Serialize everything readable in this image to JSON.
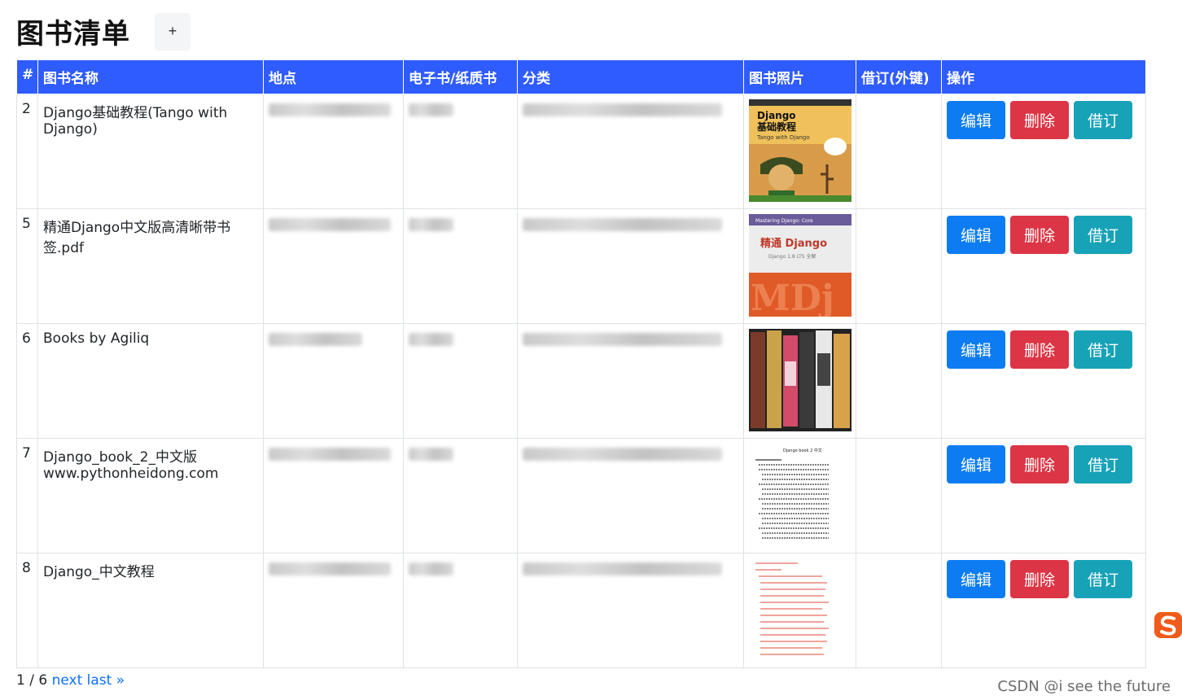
{
  "page": {
    "title": "图书清单",
    "add_label": "+"
  },
  "table": {
    "headers": [
      "#",
      "图书名称",
      "地点",
      "电子书/纸质书",
      "分类",
      "图书照片",
      "借订(外键)",
      "操作"
    ],
    "rows": [
      {
        "num": "2",
        "name": "Django基础教程(Tango with Django)",
        "cover": "cover-django-basics"
      },
      {
        "num": "5",
        "name": "精通Django中文版高清晰带书签.pdf",
        "cover": "cover-mastering-django"
      },
      {
        "num": "6",
        "name": "Books by Agiliq",
        "cover": "cover-agiliq-books"
      },
      {
        "num": "7",
        "name": "Django_book_2_中文版 www.pythonheidong.com",
        "cover": "cover-django-book-2"
      },
      {
        "num": "8",
        "name": "Django_中文教程",
        "cover": "cover-django-tutorial"
      }
    ]
  },
  "actions": {
    "edit_label": "编辑",
    "delete_label": "删除",
    "borrow_label": "借订"
  },
  "cover_texts": {
    "c1_title": "Django",
    "c1_sub": "基础教程",
    "c1_en": "Tango with Django",
    "c2_top": "Mastering Django: Core",
    "c2_title": "精通 Django",
    "c2_sub": "Django 1.8 LTS 全解",
    "c4_head": "Django book 2 中文"
  },
  "pagination": {
    "current": "1 / 6",
    "next": "next",
    "last": "last »"
  },
  "footer": {
    "watermark": "CSDN @i see the future"
  },
  "colors": {
    "header_bg": "#2f5cff",
    "edit": "#0d7cf2",
    "delete": "#dc3545",
    "borrow": "#17a2b8",
    "link": "#0d6efd"
  },
  "icons": {
    "side_logo": "sogou-logo-icon"
  }
}
